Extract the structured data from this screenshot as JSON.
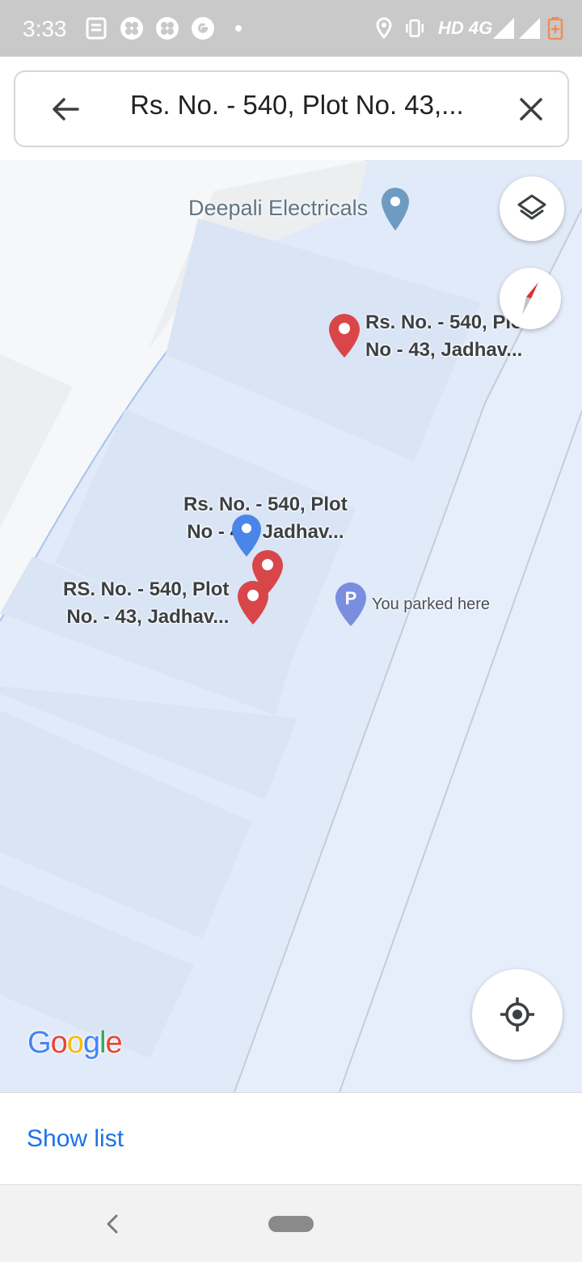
{
  "status_bar": {
    "time": "3:33",
    "left_icons": [
      "news-icon",
      "fan-icon",
      "fan-icon",
      "google-g-icon",
      "dot-icon"
    ],
    "right_icons": [
      "location-icon",
      "vibrate-icon",
      "signal-icon",
      "signal-icon",
      "battery-icon"
    ],
    "network": "HD 4G"
  },
  "search": {
    "query": "Rs. No. - 540, Plot No. 43,...",
    "back_icon": "arrow-left-icon",
    "clear_icon": "close-icon"
  },
  "map": {
    "poi_label": "Deepali Electricals",
    "markers": [
      {
        "line1": "Rs. No. - 540, Plo",
        "line2": "No - 43, Jadhav..."
      },
      {
        "line1": "Rs. No. - 540, Plot",
        "line2": "No - 43, Jadhav..."
      },
      {
        "line1": "RS. No. - 540, Plot",
        "line2": "No. - 43, Jadhav..."
      }
    ],
    "parking_label": "You parked here",
    "parking_glyph": "P",
    "logo": "Google",
    "colors": {
      "water": "#e1eaf8",
      "marker": "#d9464a",
      "blue_marker": "#4a86e8",
      "parking": "#7a8ee0",
      "link": "#1a73e8"
    }
  },
  "controls": {
    "layers_icon": "layers-icon",
    "compass_icon": "compass-icon",
    "my_location_icon": "my-location-icon"
  },
  "bottom_sheet": {
    "show_list": "Show list"
  },
  "nav": {
    "back_icon": "nav-back-icon",
    "home_icon": "home-pill-icon"
  }
}
